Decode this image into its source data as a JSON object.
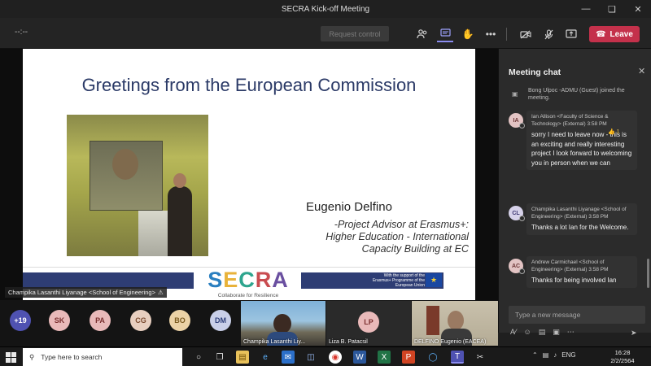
{
  "window": {
    "title": "SECRA Kick-off Meeting"
  },
  "toolbar": {
    "timer": "--:--",
    "request_control": "Request control",
    "leave_label": "Leave"
  },
  "slide": {
    "title": "Greetings from the European Commission",
    "speaker_name": "Eugenio Delfino",
    "speaker_role_1": "-Project Advisor at Erasmus+:",
    "speaker_role_2": "Higher Education - International",
    "speaker_role_3": "Capacity Building at EC",
    "logo_s": "S",
    "logo_e": "E",
    "logo_c": "C",
    "logo_r": "R",
    "logo_a": "A",
    "tagline": "Collaborate for Resilience",
    "erasmus_text": "With the support of the Erasmus+ Programme of the European Union"
  },
  "presenter_label": "Champika Lasanthi Liyanage <School of Engineering>",
  "chat": {
    "header": "Meeting chat",
    "system_message": "Bong Ulpoc -ADMU (Guest) joined the meeting.",
    "messages": [
      {
        "initials": "IA",
        "sender": "Ian Allison <Faculty of Science & Technology> (External)",
        "time": "3:58 PM",
        "reaction": "👍 1",
        "body": "sorry I need to leave now - this is an exciting and really interesting project I look forward to welcoming you in person when we can"
      },
      {
        "initials": "CL",
        "sender": "Champika Lasanthi Liyanage <School of Engineering> (External)",
        "time": "3:58 PM",
        "body": "Thanks a lot Ian for the Welcome."
      },
      {
        "initials": "AC",
        "sender": "Andrew Carmichael <School of Engineering> (External)",
        "time": "3:58 PM",
        "body": "Thanks for being involved Ian"
      }
    ],
    "input_placeholder": "Type a new message"
  },
  "participants": {
    "overflow": "+19",
    "avatars": [
      {
        "initials": "SK",
        "bg": "#e9b9b9",
        "fg": "#7a2f2f"
      },
      {
        "initials": "PA",
        "bg": "#e9b9b9",
        "fg": "#7a2f2f"
      },
      {
        "initials": "CG",
        "bg": "#e8cfc0",
        "fg": "#7a4a2f"
      },
      {
        "initials": "BO",
        "bg": "#ebd2a6",
        "fg": "#7a5a1f"
      },
      {
        "initials": "DM",
        "bg": "#c9cfe8",
        "fg": "#2f3f7a"
      }
    ],
    "tile_1_label": "Champika Lasanthi Liy...",
    "tile_2_initials": "LP",
    "tile_2_label": "Liza B. Patacsil",
    "tile_3_label": "DELFINO Eugenio (EACEA)"
  },
  "taskbar": {
    "search_placeholder": "Type here to search",
    "language": "ENG",
    "time": "16:28",
    "date": "2/2/2564"
  },
  "colors": {
    "accent": "#8b8cf0",
    "leave": "#c4314b",
    "slide_title": "#2b3a67"
  }
}
